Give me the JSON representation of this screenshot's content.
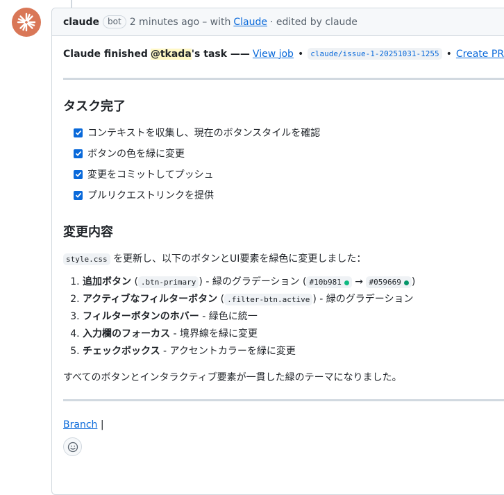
{
  "comment": {
    "author": "claude",
    "badge": "bot",
    "time": "2 minutes ago",
    "with_text": "– with",
    "app_link": "Claude",
    "edited": "· edited by claude"
  },
  "status": {
    "prefix": "Claude finished",
    "mention": "@tkada",
    "suffix": "'s task ——",
    "view_job": "View job",
    "bullet": "•",
    "branch_code": "claude/issue-1-20251031-1255",
    "create_pr": "Create PR ➔"
  },
  "tasks": {
    "heading": "タスク完了",
    "items": [
      "コンテキストを収集し、現在のボタンスタイルを確認",
      "ボタンの色を緑に変更",
      "変更をコミットしてプッシュ",
      "プルリクエストリンクを提供"
    ]
  },
  "changes": {
    "heading": "変更内容",
    "intro_code": "style.css",
    "intro_text": "を更新し、以下のボタンとUI要素を緑色に変更しました：",
    "items": [
      {
        "bold": "追加ボタン",
        "code": ".btn-primary",
        "rest": "- 緑のグラデーション (",
        "color1": "#10b981",
        "arrow": "→",
        "color2": "#059669",
        "close": ")"
      },
      {
        "bold": "アクティブなフィルターボタン",
        "code": ".filter-btn.active",
        "rest": "- 緑のグラデーション"
      },
      {
        "bold": "フィルターボタンのホバー",
        "rest": "- 緑色に統一"
      },
      {
        "bold": "入力欄のフォーカス",
        "rest": "- 境界線を緑に変更"
      },
      {
        "bold": "チェックボックス",
        "rest": "- アクセントカラーを緑に変更"
      }
    ],
    "summary": "すべてのボタンとインタラクティブ要素が一貫した緑のテーマになりました。"
  },
  "footer": {
    "branch_link": "Branch",
    "pipe": "|"
  },
  "colors": {
    "accent": "#0969da",
    "avatar_bg": "#d97757",
    "swatch1": "#10b981",
    "swatch2": "#059669"
  }
}
